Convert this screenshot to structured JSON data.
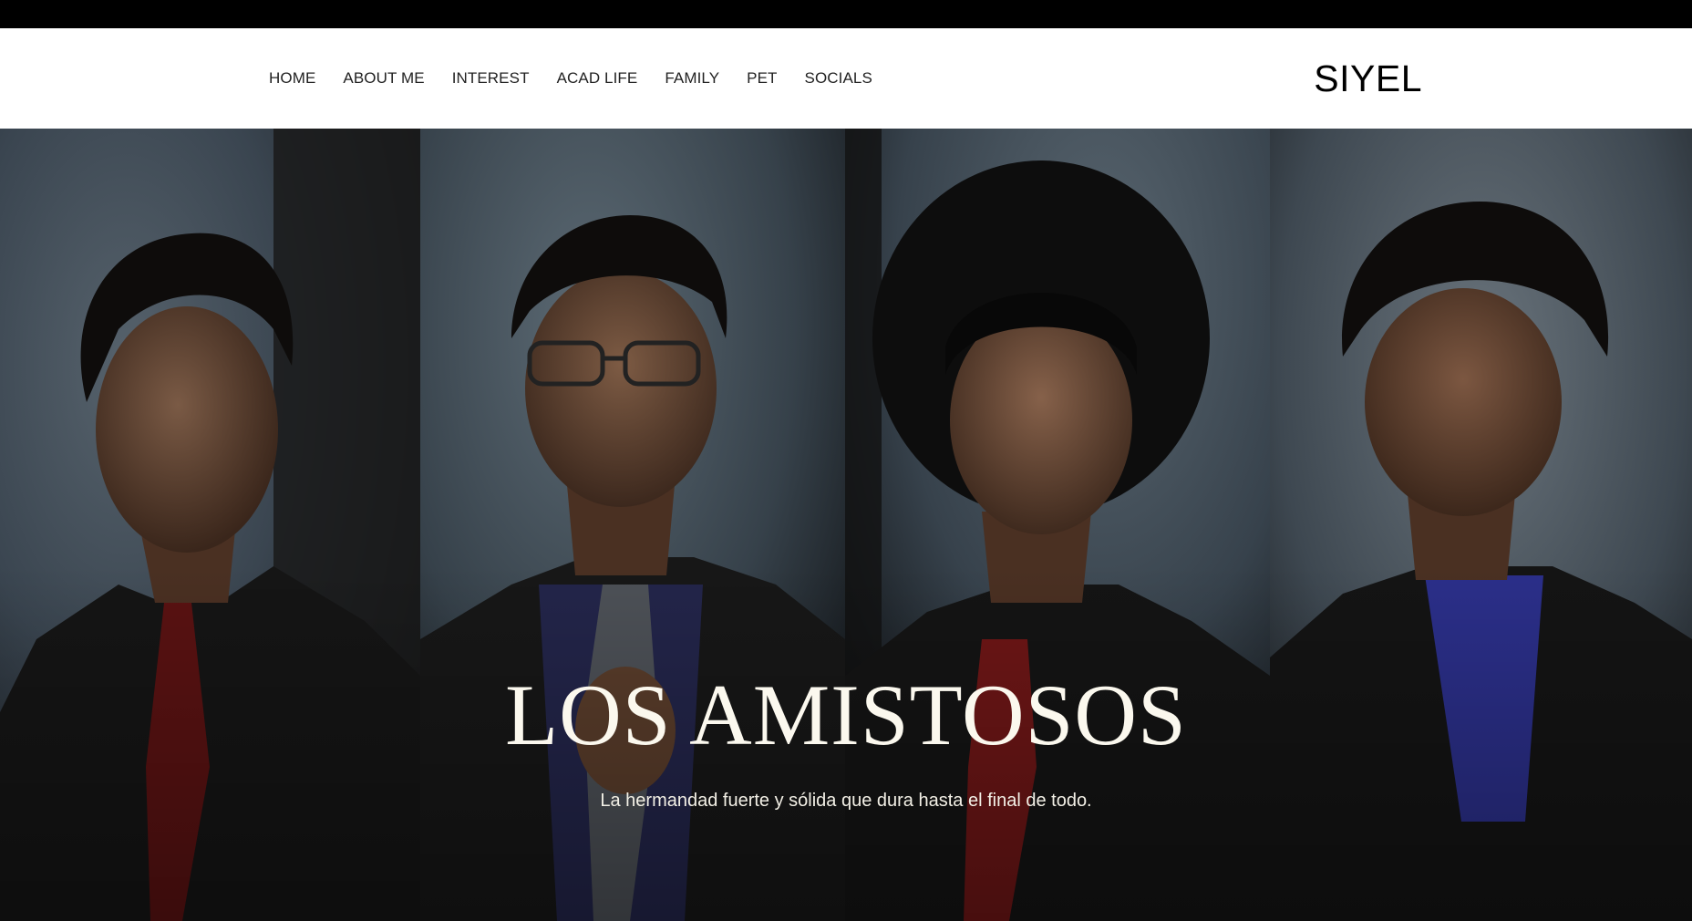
{
  "nav": {
    "items": [
      {
        "label": "HOME"
      },
      {
        "label": "ABOUT ME"
      },
      {
        "label": "INTEREST"
      },
      {
        "label": "ACAD LIFE"
      },
      {
        "label": "FAMILY"
      },
      {
        "label": "PET"
      },
      {
        "label": "SOCIALS"
      }
    ],
    "brand": "SIYEL"
  },
  "hero": {
    "title": "LOS AMISTOSOS",
    "subtitle": "La hermandad fuerte y sólida que dura hasta el final de todo."
  },
  "colors": {
    "navbar_bg": "#ffffff",
    "topbar_bg": "#000000",
    "nav_text": "#222222",
    "hero_text": "#fbf8ee",
    "backdrop": "#3d4a55"
  }
}
